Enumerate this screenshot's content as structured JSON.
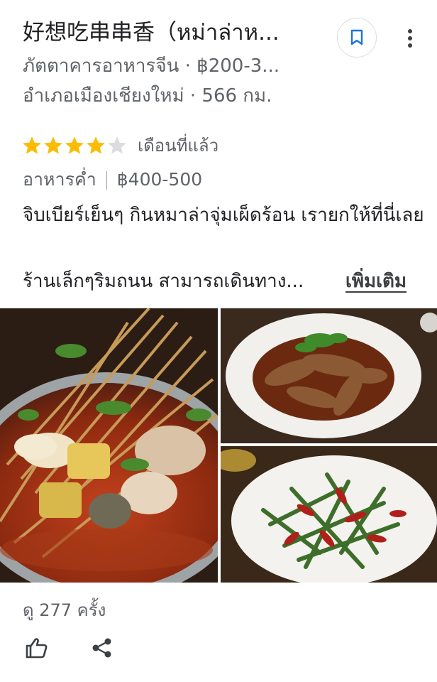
{
  "place": {
    "title": "好想吃串串香（หม่าล่าห...",
    "category_price": "ภัตตาคารอาหารจีน · ฿200-3...",
    "location_distance": "อำเภอเมืองเชียงใหม่ · 566 กม."
  },
  "review": {
    "rating": 4,
    "max_rating": 5,
    "time": "เดือนที่แล้ว",
    "meal": "อาหารค่ำ",
    "price": "฿400-500",
    "text_line1": "จิบเบียร์เย็นๆ กินหมาล่าจุ่มเผ็ดร้อน เรายกให้ที่นี่เลย",
    "text_line2": "ร้านเล็กๆริมถนน สามารถเดินทาง...",
    "more_label": "เพิ่มเติม"
  },
  "photos": [
    {
      "name": "skewers-hotpot-photo"
    },
    {
      "name": "braised-duck-neck-photo"
    },
    {
      "name": "stir-fried-green-beans-photo"
    }
  ],
  "stats": {
    "views": "ดู 277 ครั้ง"
  },
  "icons": {
    "save": "bookmark-icon",
    "more": "more-vert-icon",
    "like": "thumb-up-icon",
    "share": "share-icon"
  },
  "colors": {
    "star_filled": "#fbbc04",
    "star_empty": "#dadce0",
    "accent": "#1a73e8"
  }
}
